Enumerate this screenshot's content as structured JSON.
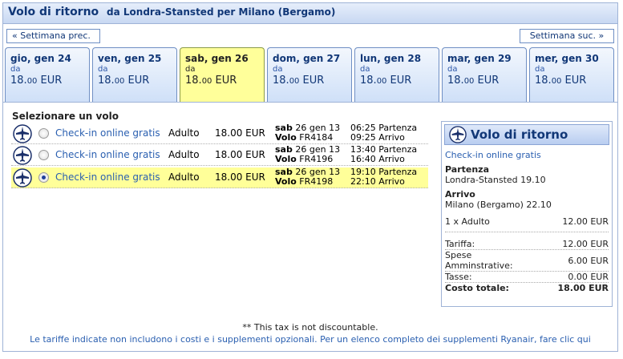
{
  "title": {
    "main": "Volo di ritorno",
    "route": "da Londra-Stansted per Milano (Bergamo)"
  },
  "nav": {
    "prev": "« Settimana prec.",
    "next": "Settimana suc. »"
  },
  "days": [
    {
      "name": "gio, gen 24",
      "da": "da",
      "price": "18.",
      "cents": "00",
      "currency": " EUR",
      "selected": false
    },
    {
      "name": "ven, gen 25",
      "da": "da",
      "price": "18.",
      "cents": "00",
      "currency": " EUR",
      "selected": false
    },
    {
      "name": "sab, gen 26",
      "da": "da",
      "price": "18.",
      "cents": "00",
      "currency": " EUR",
      "selected": true
    },
    {
      "name": "dom, gen 27",
      "da": "da",
      "price": "18.",
      "cents": "00",
      "currency": " EUR",
      "selected": false
    },
    {
      "name": "lun, gen 28",
      "da": "da",
      "price": "18.",
      "cents": "00",
      "currency": " EUR",
      "selected": false
    },
    {
      "name": "mar, gen 29",
      "da": "da",
      "price": "18.",
      "cents": "00",
      "currency": " EUR",
      "selected": false
    },
    {
      "name": "mer, gen 30",
      "da": "da",
      "price": "18.",
      "cents": "00",
      "currency": " EUR",
      "selected": false
    }
  ],
  "flights_title": "Selezionare un volo",
  "flights": [
    {
      "checkin": "Check-in online gratis",
      "pax": "Adulto",
      "price": "18.00 EUR",
      "day": "sab",
      "date": "26 gen 13",
      "volo_label": "Volo",
      "volo": "FR4184",
      "dep": "06:25 Partenza",
      "arr": "09:25 Arrivo",
      "selected": false
    },
    {
      "checkin": "Check-in online gratis",
      "pax": "Adulto",
      "price": "18.00 EUR",
      "day": "sab",
      "date": "26 gen 13",
      "volo_label": "Volo",
      "volo": "FR4196",
      "dep": "13:40 Partenza",
      "arr": "16:40 Arrivo",
      "selected": false
    },
    {
      "checkin": "Check-in online gratis",
      "pax": "Adulto",
      "price": "18.00 EUR",
      "day": "sab",
      "date": "26 gen 13",
      "volo_label": "Volo",
      "volo": "FR4198",
      "dep": "19:10 Partenza",
      "arr": "22:10 Arrivo",
      "selected": true
    }
  ],
  "summary": {
    "heading": "Volo di ritorno",
    "checkin": "Check-in online gratis",
    "dep_label": "Partenza",
    "dep_value": "Londra-Stansted 19.10",
    "arr_label": "Arrivo",
    "arr_value": "Milano (Bergamo) 22.10",
    "pax_label": "1 x Adulto",
    "pax_value": "12.00 EUR",
    "tariffa_label": "Tariffa:",
    "tariffa_value": "12.00 EUR",
    "spese_label1": "Spese",
    "spese_label2": "Amminstrative:",
    "spese_value": "6.00 EUR",
    "tasse_label": "Tasse:",
    "tasse_value": "0.00 EUR",
    "total_label": "Costo totale:",
    "total_value": "18.00 EUR"
  },
  "footer": {
    "note": "** This tax is not discountable.",
    "info": "Le tariffe indicate non includono i costi e i supplementi opzionali. Per un elenco completo dei supplementi Ryanair, fare clic qui"
  },
  "colors": {
    "accent": "#113777",
    "link": "#2a5fb0",
    "selected_bg": "#ffff99",
    "border": "#9fb3d6"
  }
}
